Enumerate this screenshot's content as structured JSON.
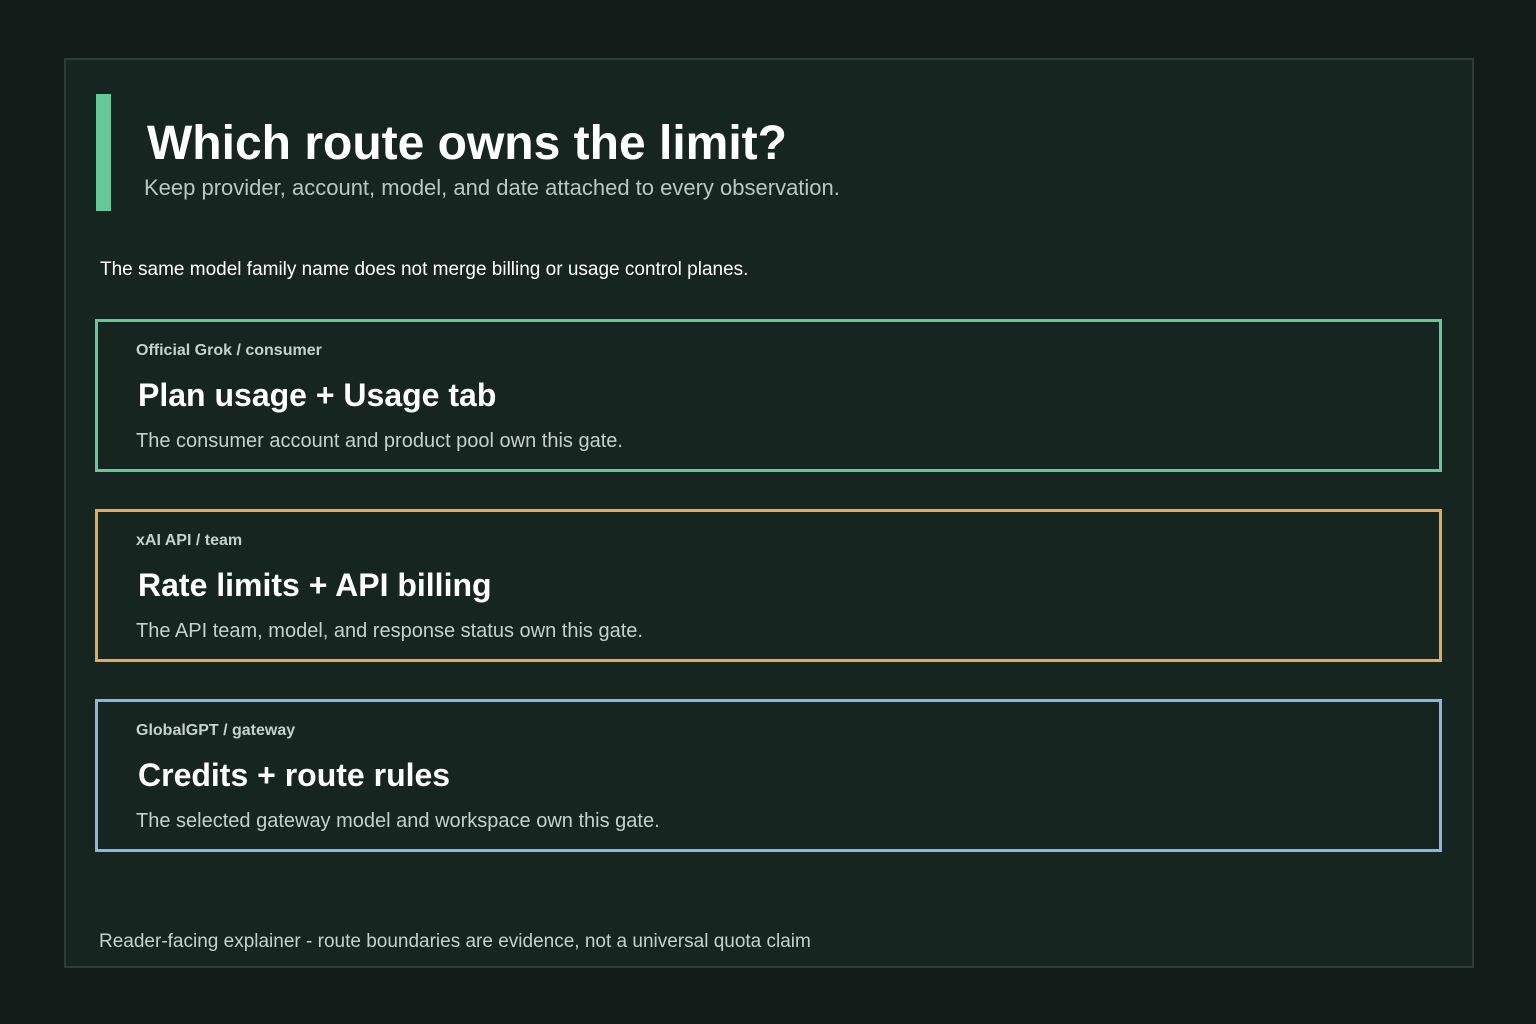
{
  "header": {
    "title": "Which route owns the limit?",
    "subtitle": "Keep provider, account, model, and date attached to every observation."
  },
  "intro": "The same model family name does not merge billing or usage control planes.",
  "colors": {
    "background": "#111b18",
    "panel": "#172520",
    "accent": "#65c899",
    "card_consumer": "#65c899",
    "card_api": "#e7a857",
    "card_gateway": "#8ab4e2"
  },
  "cards": [
    {
      "label": "Official Grok / consumer",
      "title": "Plan usage + Usage tab",
      "description": "The consumer account and product pool own this gate.",
      "border_color": "#65c899"
    },
    {
      "label": "xAI API / team",
      "title": "Rate limits + API billing",
      "description": "The API team, model, and response status own this gate.",
      "border_color": "#e7a857"
    },
    {
      "label": "GlobalGPT / gateway",
      "title": "Credits + route rules",
      "description": "The selected gateway model and workspace own this gate.",
      "border_color": "#8ab4e2"
    }
  ],
  "footer": "Reader-facing explainer - route boundaries are evidence, not a universal quota claim"
}
